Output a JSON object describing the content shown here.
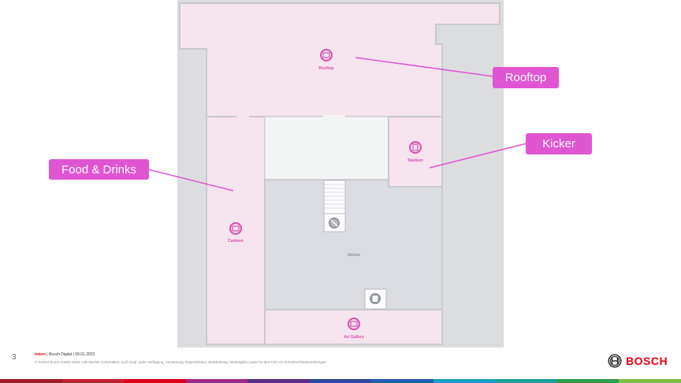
{
  "map": {
    "rooms": [
      {
        "id": "rooftop",
        "label": "Rooftop",
        "icon": "rooftop-icon"
      },
      {
        "id": "stadium",
        "label": "Stadium",
        "icon": "stadium-icon"
      },
      {
        "id": "canteen",
        "label": "Canteen",
        "icon": "canteen-icon"
      },
      {
        "id": "atrium",
        "label": "Atrium"
      },
      {
        "id": "art-gallery",
        "label": "Art Gallery",
        "icon": "art-gallery-icon"
      }
    ],
    "callouts": {
      "rooftop": "Rooftop",
      "kicker": "Kicker",
      "food": "Food & Drinks"
    },
    "colors": {
      "background": "#dcdddf",
      "room_pink": "#f6e4ee",
      "room_gray": "#dadce2",
      "stair_area": "#f3f4f4",
      "accent": "#e055d2",
      "icon_pink": "#d84fb0"
    }
  },
  "footer": {
    "page_number": "3",
    "classification": "intern",
    "meta": " | Bosch Digital | 09.01.2023",
    "copyright": "© Robert Bosch GmbH 2022. Alle Rechte vorbehalten, auch bzgl. jeder Verfügung, Verwertung, Reproduktion, Bearbeitung, Weitergabe sowie für den Fall von Schutzrechtsanmeldungen.",
    "brand": "BOSCH",
    "rainbow": [
      "#a31c2b",
      "#c4212f",
      "#e20015",
      "#9a2b8c",
      "#5a2d84",
      "#2d4a9c",
      "#1f5fae",
      "#17a0c6",
      "#1aa29a",
      "#2f9e48",
      "#7cc242"
    ]
  }
}
